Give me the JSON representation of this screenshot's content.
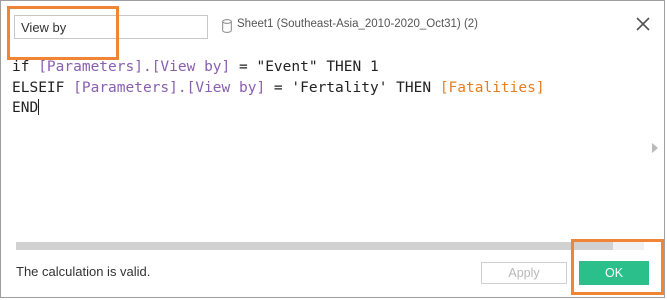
{
  "dialog": {
    "name_field": {
      "value": "View by"
    },
    "datasource_label": "Sheet1 (Southeast-Asia_2010-2020_Oct31) (2)",
    "icons": {
      "datasource": "database-icon",
      "close": "close-icon",
      "scroll_right": "triangle-right-icon"
    }
  },
  "editor": {
    "line1": {
      "kw_if": "if",
      "param": "[Parameters].[View by]",
      "op": "=",
      "str": "\"Event\"",
      "kw_then": "THEN",
      "num": "1"
    },
    "line2": {
      "kw_elseif": "ELSEIF",
      "param": "[Parameters].[View by]",
      "op": "=",
      "str": "'Fertality'",
      "kw_then": "THEN",
      "field": "[Fatalities]"
    },
    "line3": {
      "kw_end": "END"
    }
  },
  "footer": {
    "status": "The calculation is valid.",
    "apply_label": "Apply",
    "ok_label": "OK"
  },
  "colors": {
    "parameter": "#8a5fb0",
    "field": "#e67e22",
    "ok_button": "#2bbf8c",
    "highlight": "#ef8535"
  }
}
